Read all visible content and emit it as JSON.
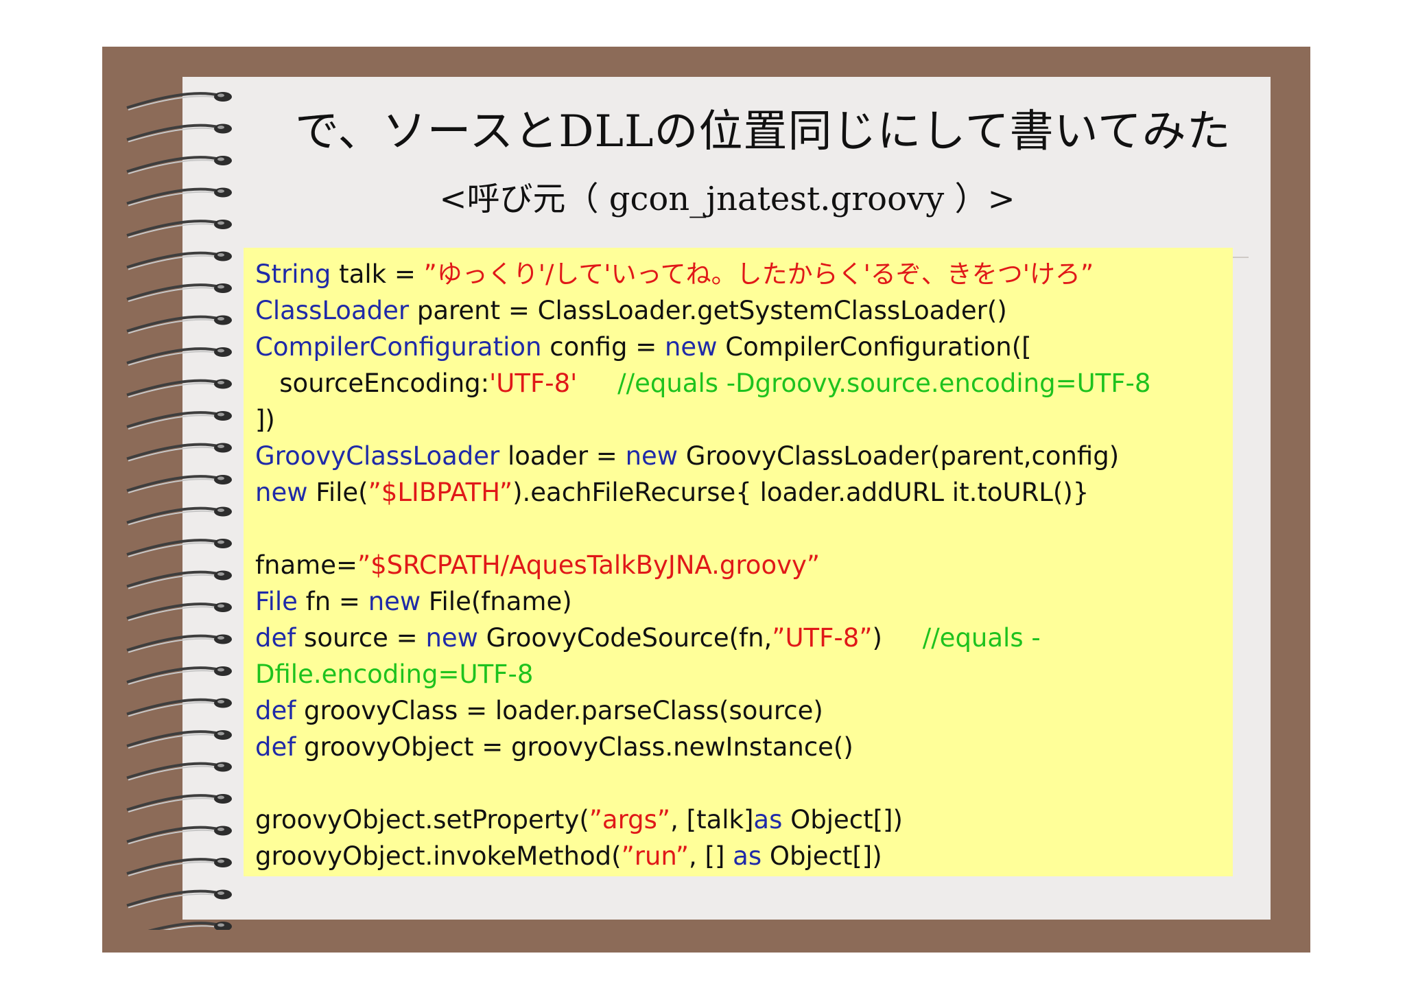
{
  "title": "で、ソースとDLLの位置同じにして書いてみた",
  "subtitle": "<呼び元（ gcon_jnatest.groovy ）>",
  "code": [
    [
      {
        "t": "String",
        "c": "kw"
      },
      {
        "t": " talk = ",
        "c": ""
      },
      {
        "t": "”ゆっくり'/して'いってね。したからく'るぞ、きをつ'けろ”",
        "c": "st"
      }
    ],
    [
      {
        "t": "ClassLoader",
        "c": "kw"
      },
      {
        "t": " parent = ClassLoader.getSystemClassLoader()",
        "c": ""
      }
    ],
    [
      {
        "t": "CompilerConfiguration",
        "c": "kw"
      },
      {
        "t": " config = ",
        "c": ""
      },
      {
        "t": "new",
        "c": "kw"
      },
      {
        "t": " CompilerConfiguration([",
        "c": ""
      }
    ],
    [
      {
        "t": "   sourceEncoding:",
        "c": ""
      },
      {
        "t": "'UTF-8'",
        "c": "st"
      },
      {
        "t": "     //equals -Dgroovy.source.encoding=UTF-8",
        "c": "cm"
      }
    ],
    [
      {
        "t": "])",
        "c": ""
      }
    ],
    [
      {
        "t": "GroovyClassLoader",
        "c": "kw"
      },
      {
        "t": " loader = ",
        "c": ""
      },
      {
        "t": "new",
        "c": "kw"
      },
      {
        "t": " GroovyClassLoader(parent,config)",
        "c": ""
      }
    ],
    [
      {
        "t": "new",
        "c": "kw"
      },
      {
        "t": " File(",
        "c": ""
      },
      {
        "t": "”$LIBPATH”",
        "c": "st"
      },
      {
        "t": ").eachFileRecurse{ loader.addURL it.toURL()}",
        "c": ""
      }
    ],
    [],
    [
      {
        "t": "fname=",
        "c": ""
      },
      {
        "t": "”$SRCPATH/AquesTalkByJNA.groovy”",
        "c": "st"
      }
    ],
    [
      {
        "t": "File",
        "c": "kw"
      },
      {
        "t": " fn = ",
        "c": ""
      },
      {
        "t": "new",
        "c": "kw"
      },
      {
        "t": " File(fname)",
        "c": ""
      }
    ],
    [
      {
        "t": "def",
        "c": "kw"
      },
      {
        "t": " source = ",
        "c": ""
      },
      {
        "t": "new",
        "c": "kw"
      },
      {
        "t": " GroovyCodeSource(fn,",
        "c": ""
      },
      {
        "t": "”UTF-8”",
        "c": "st"
      },
      {
        "t": ")",
        "c": ""
      },
      {
        "t": "     //equals -",
        "c": "cm"
      }
    ],
    [
      {
        "t": "Dfile.encoding=UTF-8",
        "c": "cm"
      }
    ],
    [
      {
        "t": "def",
        "c": "kw"
      },
      {
        "t": " groovyClass = loader.parseClass(source)",
        "c": ""
      }
    ],
    [
      {
        "t": "def",
        "c": "kw"
      },
      {
        "t": " groovyObject = groovyClass.newInstance()",
        "c": ""
      }
    ],
    [],
    [
      {
        "t": "groovyObject.setProperty(",
        "c": ""
      },
      {
        "t": "”args”",
        "c": "st"
      },
      {
        "t": ", [talk]",
        "c": ""
      },
      {
        "t": "as",
        "c": "kw"
      },
      {
        "t": " Object[])",
        "c": ""
      }
    ],
    [
      {
        "t": "groovyObject.invokeMethod(",
        "c": ""
      },
      {
        "t": "”run”",
        "c": "st"
      },
      {
        "t": ", [] ",
        "c": ""
      },
      {
        "t": "as",
        "c": "kw"
      },
      {
        "t": " Object[])",
        "c": ""
      }
    ]
  ]
}
